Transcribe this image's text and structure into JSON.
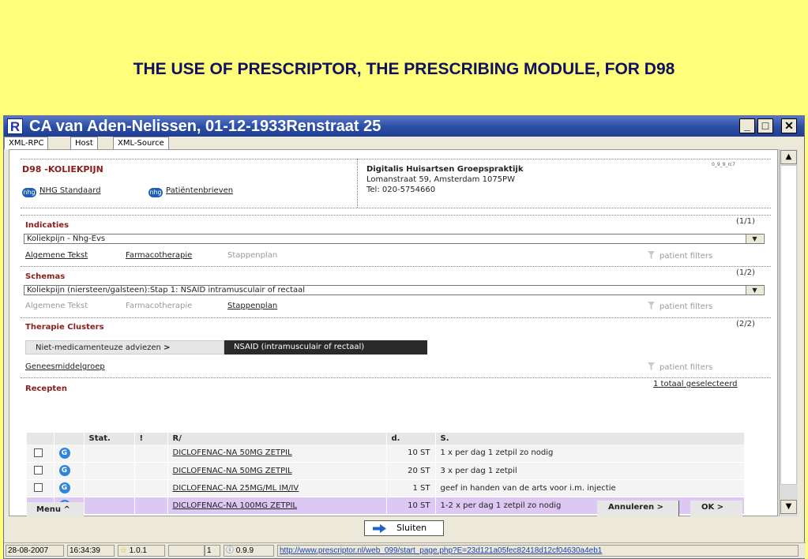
{
  "slide_title": "THE USE OF PRESCRIPTOR, THE PRESCRIBING MODULE, FOR D98",
  "window": {
    "app_icon": "R",
    "title": "CA van Aden-Nelissen, 01-12-1933Renstraat 25",
    "controls": {
      "minimize": "_",
      "maximize": "□",
      "close": "✕"
    }
  },
  "tabs": [
    "XML-RPC",
    "Host",
    "XML-Source"
  ],
  "header": {
    "code_title": "D98 -KOLIEKPIJN",
    "logo_text": "nhg",
    "links": [
      "NHG Standaard",
      "Patiëntenbrieven"
    ],
    "practice_name": "Digitalis Huisartsen Groepspraktijk",
    "practice_address": "Lomanstraat 59, Amsterdam 1075PW",
    "practice_tel": "Tel: 020-5754660",
    "version": "0_9_9_rc7"
  },
  "indicaties": {
    "label": "Indicaties",
    "count": "(1/1)",
    "selected": "Koliekpijn - Nhg-Evs",
    "links": [
      "Algemene Tekst",
      "Farmacotherapie",
      "Stappenplan"
    ],
    "filter": "patient filters"
  },
  "schemas": {
    "label": "Schemas",
    "count": "(1/2)",
    "selected": "Koliekpijn (niersteen/galsteen):Stap 1: NSAID intramusculair of rectaal",
    "links": [
      "Algemene Tekst",
      "Farmacotherapie",
      "Stappenplan"
    ],
    "filter": "patient filters"
  },
  "therapie": {
    "label": "Therapie Clusters",
    "count": "(2/2)",
    "cluster1": "Niet-medicamenteuze adviezen",
    "cluster2": "NSAID (intramusculair of rectaal)",
    "group_link": "Geneesmiddelgroep",
    "filter": "patient filters"
  },
  "recepten": {
    "label": "Recepten",
    "selected_total": "1 totaal geselecteerd",
    "columns": [
      "",
      "",
      "Stat.",
      "!",
      "R/",
      "d.",
      "S."
    ],
    "rows": [
      {
        "checked": false,
        "icon": "G",
        "drug": "DICLOFENAC-NA 50MG ZETPIL",
        "qty": "10 ST",
        "sig": "1 x per dag 1 zetpil zo nodig"
      },
      {
        "checked": false,
        "icon": "G",
        "drug": "DICLOFENAC-NA 50MG ZETPIL",
        "qty": "20 ST",
        "sig": "3 x per dag 1 zetpil"
      },
      {
        "checked": false,
        "icon": "G",
        "drug": "DICLOFENAC-NA 25MG/ML IM/IV",
        "qty": "1 ST",
        "sig": "geef in handen van de arts voor i.m. injectie"
      },
      {
        "checked": true,
        "icon": "G",
        "drug": "DICLOFENAC-NA 100MG ZETPIL",
        "qty": "10 ST",
        "sig": "1-2 x per dag 1 zetpil zo nodig"
      }
    ]
  },
  "footer": {
    "menu": "Menu ^",
    "cancel": "Annuleren >",
    "ok": "OK >",
    "close_button": "Sluiten"
  },
  "statusbar": {
    "date": "28-08-2007",
    "time": "16:34:39",
    "star_version": "1.0.1",
    "count": "1",
    "info_version": "0.9.9",
    "url": "http://www.prescriptor.nl/web_099/start_page.php?E=23d121a05fec82418d12cf04630a4eb1"
  },
  "colors": {
    "slide_bg": "#fefe7a",
    "title_bar": "#2c4fa6",
    "section_label": "#8a1c1c",
    "selected_row": "#ddc8f4"
  }
}
